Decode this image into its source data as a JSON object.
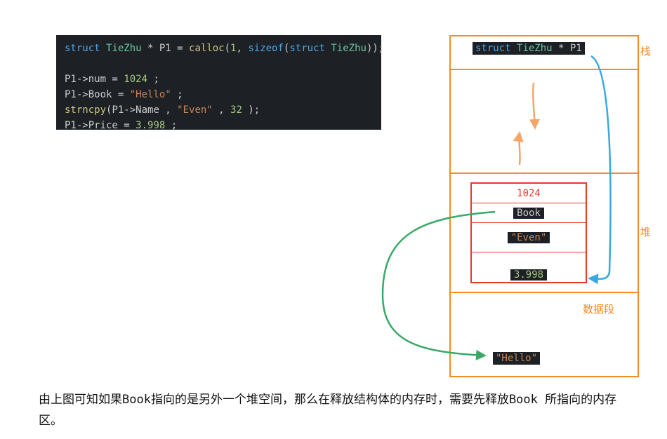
{
  "code": {
    "l1_a": "struct",
    "l1_b": "TieZhu",
    "l1_c": " * P1 = ",
    "l1_d": "calloc",
    "l1_e": "(",
    "l1_f": "1",
    "l1_g": ", ",
    "l1_h": "sizeof",
    "l1_i": "(",
    "l1_j": "struct",
    "l1_k": " TieZhu",
    "l1_l": "));",
    "l2_a": "P1->num = ",
    "l2_b": "1024",
    "l2_c": " ;",
    "l3_a": "P1->Book = ",
    "l3_b": "\"Hello\"",
    "l3_c": " ;",
    "l4_a": "strncpy",
    "l4_b": "(P1->Name , ",
    "l4_c": "\"Even\"",
    "l4_d": " , ",
    "l4_e": "32",
    "l4_f": " );",
    "l5_a": "P1->Price = ",
    "l5_b": "3.998",
    "l5_c": " ;"
  },
  "labels": {
    "stack": "栈",
    "heap": "堆",
    "data": "数据段"
  },
  "stack_decl": {
    "kw": "struct",
    "typ": "TieZhu",
    "rest": " * P1"
  },
  "struct_fields": {
    "num": "1024",
    "book": "Book",
    "name": "\"Even\"",
    "price": "3.998"
  },
  "data_seg": {
    "hello": "\"Hello\""
  },
  "caption": "由上图可知如果Book指向的是另外一个堆空间，那么在释放结构体的内存时，需要先释放Book 所指向的内存区。"
}
